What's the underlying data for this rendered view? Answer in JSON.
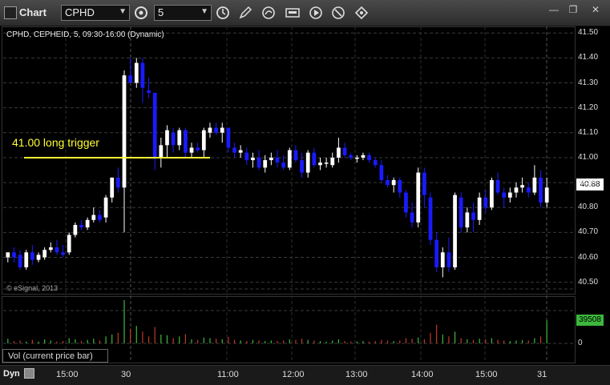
{
  "window": {
    "title": "Chart"
  },
  "toolbar": {
    "symbol_value": "CPHD",
    "interval_value": "5",
    "icons": [
      "interval-settings-icon",
      "time-template-icon",
      "draw-pencil-icon",
      "refresh-icon",
      "ticker-icon",
      "play-icon",
      "search-icon",
      "cursor-tool-icon"
    ]
  },
  "chart": {
    "legend": "CPHD, CEPHEID, 5, 09:30-16:00 (Dynamic)",
    "copyright": "© eSignal, 2013",
    "annotation": "41.00 long trigger",
    "last_price": "40.88",
    "last_volume": "39508",
    "volume_label": "Vol (current price bar)",
    "volume_zero": "0",
    "bottom_mode": "Dyn"
  },
  "colors": {
    "up": "#ffffff",
    "down": "#1a1aff",
    "annotation": "#ffff33",
    "volume_up": "#3db83d",
    "volume_down": "#c0392b"
  },
  "chart_data": {
    "type": "candlestick",
    "y_ticks": [
      "41.50",
      "41.40",
      "41.30",
      "41.20",
      "41.10",
      "41.00",
      "40.90",
      "40.80",
      "40.70",
      "40.60",
      "40.50"
    ],
    "ylim": [
      40.47,
      41.52
    ],
    "x_ticks": [
      "15:00",
      "30",
      "11:00",
      "12:00",
      "13:00",
      "14:00",
      "15:00",
      "31"
    ],
    "annotation_level": 41.0,
    "candles": [
      [
        40.6,
        40.62,
        40.58,
        40.62
      ],
      [
        40.62,
        40.64,
        40.58,
        40.6
      ],
      [
        40.61,
        40.63,
        40.55,
        40.56
      ],
      [
        40.56,
        40.63,
        40.55,
        40.62
      ],
      [
        40.62,
        40.65,
        40.57,
        40.59
      ],
      [
        40.59,
        40.62,
        40.58,
        40.61
      ],
      [
        40.6,
        40.64,
        40.59,
        40.63
      ],
      [
        40.63,
        40.66,
        40.62,
        40.64
      ],
      [
        40.64,
        40.67,
        40.61,
        40.62
      ],
      [
        40.62,
        40.65,
        40.6,
        40.61
      ],
      [
        40.62,
        40.7,
        40.61,
        40.69
      ],
      [
        40.69,
        40.74,
        40.68,
        40.73
      ],
      [
        40.73,
        40.75,
        40.71,
        40.72
      ],
      [
        40.72,
        40.76,
        40.71,
        40.75
      ],
      [
        40.75,
        40.8,
        40.74,
        40.77
      ],
      [
        40.77,
        40.79,
        40.74,
        40.75
      ],
      [
        40.76,
        40.85,
        40.74,
        40.84
      ],
      [
        40.84,
        40.92,
        40.82,
        40.92
      ],
      [
        40.92,
        40.96,
        40.86,
        40.88
      ],
      [
        40.88,
        41.35,
        40.7,
        41.33
      ],
      [
        41.33,
        41.4,
        41.3,
        41.3
      ],
      [
        41.3,
        41.4,
        41.28,
        41.38
      ],
      [
        41.38,
        41.4,
        41.22,
        41.28
      ],
      [
        41.27,
        41.32,
        41.24,
        41.26
      ],
      [
        41.26,
        41.26,
        40.95,
        41.0
      ],
      [
        41.0,
        41.08,
        40.96,
        41.05
      ],
      [
        41.05,
        41.13,
        41.0,
        41.11
      ],
      [
        41.1,
        41.12,
        41.02,
        41.05
      ],
      [
        41.05,
        41.12,
        41.03,
        41.11
      ],
      [
        41.11,
        41.12,
        41.0,
        41.02
      ],
      [
        41.02,
        41.06,
        41.0,
        41.04
      ],
      [
        41.04,
        41.06,
        41.02,
        41.03
      ],
      [
        41.03,
        41.12,
        41.0,
        41.11
      ],
      [
        41.1,
        41.14,
        41.08,
        41.12
      ],
      [
        41.12,
        41.14,
        41.09,
        41.1
      ],
      [
        41.1,
        41.14,
        41.06,
        41.12
      ],
      [
        41.12,
        41.12,
        41.02,
        41.04
      ],
      [
        41.04,
        41.06,
        41.0,
        41.02
      ],
      [
        41.02,
        41.05,
        41.0,
        41.03
      ],
      [
        41.02,
        41.04,
        40.97,
        40.99
      ],
      [
        40.99,
        41.02,
        40.96,
        41.0
      ],
      [
        41.0,
        41.03,
        40.95,
        40.96
      ],
      [
        40.96,
        41.01,
        40.94,
        40.99
      ],
      [
        40.99,
        41.02,
        40.97,
        41.0
      ],
      [
        41.0,
        41.03,
        40.96,
        40.98
      ],
      [
        40.98,
        41.01,
        40.95,
        40.96
      ],
      [
        40.96,
        41.04,
        40.95,
        41.03
      ],
      [
        41.03,
        41.05,
        40.98,
        40.99
      ],
      [
        40.99,
        41.02,
        40.92,
        40.94
      ],
      [
        40.94,
        41.03,
        40.92,
        41.02
      ],
      [
        41.02,
        41.04,
        40.96,
        40.97
      ],
      [
        40.97,
        41.0,
        40.95,
        40.98
      ],
      [
        40.98,
        41.0,
        40.96,
        40.98
      ],
      [
        40.97,
        41.02,
        40.96,
        41.0
      ],
      [
        41.0,
        41.08,
        40.98,
        41.04
      ],
      [
        41.04,
        41.06,
        41.0,
        41.01
      ],
      [
        41.01,
        41.02,
        40.99,
        41.0
      ],
      [
        41.0,
        41.01,
        40.98,
        41.0
      ],
      [
        41.0,
        41.02,
        40.99,
        41.01
      ],
      [
        41.01,
        41.02,
        40.98,
        40.99
      ],
      [
        40.99,
        41.0,
        40.96,
        40.97
      ],
      [
        40.97,
        40.99,
        40.9,
        40.91
      ],
      [
        40.91,
        40.93,
        40.88,
        40.89
      ],
      [
        40.89,
        40.92,
        40.86,
        40.91
      ],
      [
        40.91,
        40.92,
        40.84,
        40.86
      ],
      [
        40.86,
        40.87,
        40.76,
        40.78
      ],
      [
        40.78,
        40.82,
        40.72,
        40.74
      ],
      [
        40.74,
        40.96,
        40.72,
        40.94
      ],
      [
        40.94,
        40.96,
        40.8,
        40.85
      ],
      [
        40.84,
        40.86,
        40.65,
        40.67
      ],
      [
        40.67,
        40.7,
        40.54,
        40.56
      ],
      [
        40.56,
        40.64,
        40.52,
        40.62
      ],
      [
        40.62,
        40.68,
        40.54,
        40.56
      ],
      [
        40.56,
        40.86,
        40.55,
        40.85
      ],
      [
        40.84,
        40.86,
        40.7,
        40.72
      ],
      [
        40.72,
        40.8,
        40.7,
        40.78
      ],
      [
        40.78,
        40.82,
        40.7,
        40.75
      ],
      [
        40.75,
        40.86,
        40.73,
        40.84
      ],
      [
        40.84,
        40.87,
        40.78,
        40.8
      ],
      [
        40.8,
        40.92,
        40.79,
        40.91
      ],
      [
        40.91,
        40.94,
        40.85,
        40.86
      ],
      [
        40.86,
        40.88,
        40.8,
        40.84
      ],
      [
        40.84,
        40.88,
        40.82,
        40.86
      ],
      [
        40.86,
        40.9,
        40.84,
        40.88
      ],
      [
        40.88,
        40.92,
        40.86,
        40.89
      ],
      [
        40.88,
        40.9,
        40.84,
        40.86
      ],
      [
        40.86,
        40.97,
        40.85,
        40.92
      ],
      [
        40.92,
        40.95,
        40.8,
        40.82
      ],
      [
        40.82,
        40.92,
        40.8,
        40.88
      ]
    ],
    "volume": [
      800,
      400,
      500,
      300,
      600,
      300,
      700,
      500,
      300,
      400,
      900,
      700,
      400,
      600,
      800,
      500,
      1200,
      1500,
      1800,
      7400,
      2500,
      3000,
      2000,
      1200,
      2800,
      1500,
      1400,
      900,
      1200,
      1600,
      700,
      600,
      1000,
      900,
      800,
      700,
      1100,
      600,
      500,
      400,
      600,
      500,
      400,
      500,
      400,
      500,
      700,
      600,
      800,
      600,
      500,
      400,
      300,
      500,
      700,
      400,
      300,
      300,
      400,
      300,
      400,
      600,
      500,
      400,
      500,
      900,
      800,
      1000,
      700,
      1800,
      3200,
      1500,
      1200,
      2000,
      900,
      700,
      600,
      800,
      700,
      900,
      600,
      500,
      400,
      500,
      600,
      500,
      900,
      1200,
      3950
    ]
  }
}
